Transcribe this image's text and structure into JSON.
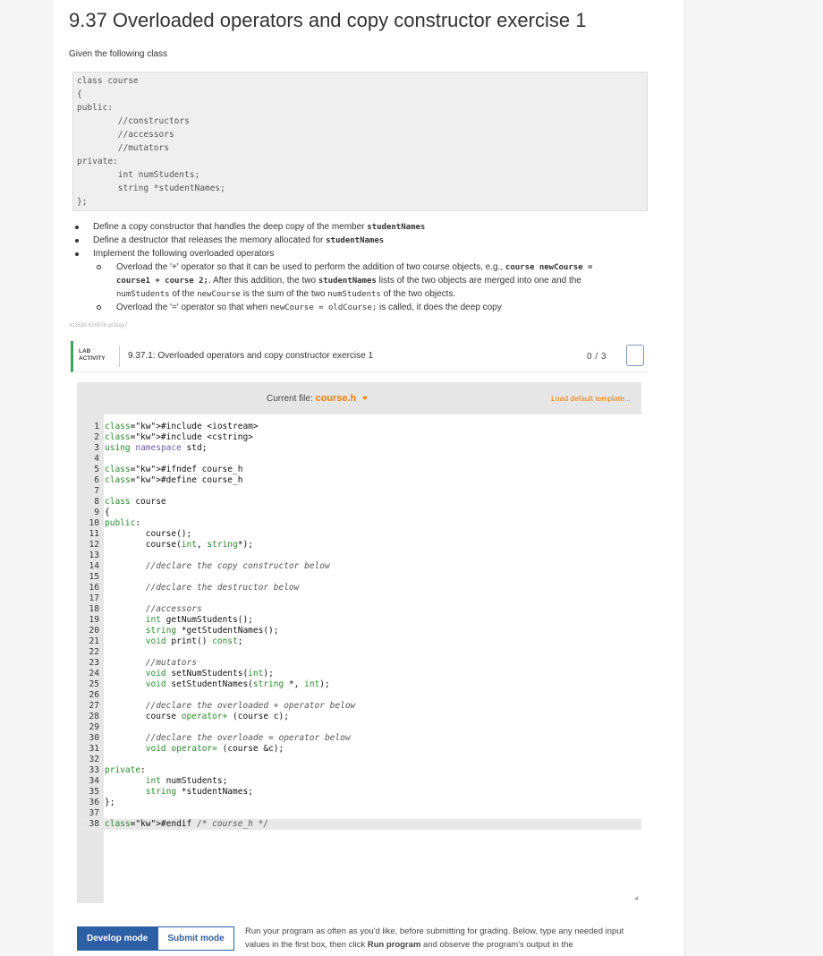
{
  "title": "9.37 Overloaded operators and copy constructor exercise 1",
  "intro": "Given the following class",
  "class_snippet": [
    "class course",
    "{",
    "public:",
    "        //constructors",
    "        //accessors",
    "        //mutators",
    "private:",
    "        int numStudents;",
    "        string *studentNames;",
    "};"
  ],
  "bullets": {
    "b1_pre": "Define a copy constructor that handles the deep copy of the member ",
    "b1_code": "studentNames",
    "b2_pre": "Define a destructor that releases the memory allocated for ",
    "b2_code": "studentNames",
    "b3": "Implement the following overloaded operators",
    "s1_l1_pre": "Overload the '+' operator so that it can be used to perform the addition of two course objects, e.g., ",
    "s1_l1_code": "course newCourse =",
    "s1_l2_code": "course1 + course 2;",
    "s1_l2_mid": ". After this addition, the two ",
    "s1_l2_code2": "studentNames",
    "s1_l2_post": " lists of the two objects are merged into one and the",
    "s1_l3_code": "numStudents",
    "s1_l3_mid": " of the ",
    "s1_l3_code2": "newCourse",
    "s1_l3_mid2": " is the sum of the two ",
    "s1_l3_code3": "numStudents",
    "s1_l3_post": " of the two objects.",
    "s2_pre": "Overload the '=' operator so that when ",
    "s2_code": "newCourse = oldCourse;",
    "s2_post": " is called, it does the deep copy"
  },
  "tiny_id": "413530.616576.qx3zqy7",
  "lab": {
    "tag_line1": "LAB",
    "tag_line2": "ACTIVITY",
    "title": "9.37.1: Overloaded operators and copy constructor exercise 1",
    "score": "0 / 3"
  },
  "editor": {
    "current_file_label": "Current file:",
    "current_file": "course.h",
    "load_default": "Load default template...",
    "active_line": 38
  },
  "code_lines": [
    "#include <iostream>",
    "#include <cstring>",
    "using namespace std;",
    "",
    "#ifndef course_h",
    "#define course_h",
    "",
    "class course",
    "{",
    "public:",
    "        course();",
    "        course(int, string*);",
    "",
    "        //declare the copy constructor below",
    "",
    "        //declare the destructor below",
    "",
    "        //accessors",
    "        int getNumStudents();",
    "        string *getStudentNames();",
    "        void print() const;",
    "",
    "        //mutators",
    "        void setNumStudents(int);",
    "        void setStudentNames(string *, int);",
    "",
    "        //declare the overloaded + operator below",
    "        course operator+ (course c);",
    "",
    "        //declare the overloade = operator below",
    "        void operator= (course &c);",
    "",
    "private:",
    "        int numStudents;",
    "        string *studentNames;",
    "};",
    "",
    "#endif /* course_h */"
  ],
  "buttons": {
    "develop": "Develop mode",
    "submit": "Submit mode"
  },
  "run_text_pre": "Run your program as often as you'd like, before submitting for grading. Below, type any needed input values in the first box, then click ",
  "run_text_bold": "Run program",
  "run_text_post": " and observe the program's output in the"
}
